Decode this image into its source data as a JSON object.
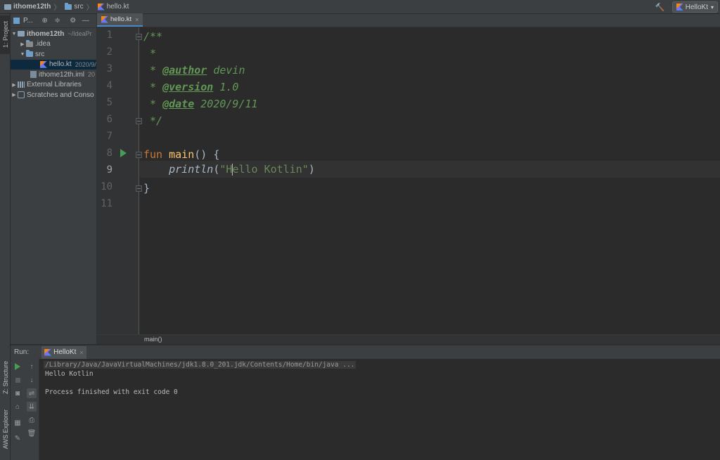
{
  "navbar": {
    "breadcrumb": [
      "ithome12th",
      "src",
      "hello.kt"
    ],
    "run_config": "HelloKt"
  },
  "left_strip": {
    "project_tab": "1: Project",
    "structure_tab": "Z: Structure",
    "aws_tab": "AWS Explorer"
  },
  "project_panel": {
    "title": "P...",
    "tree": [
      {
        "label": "ithome12th",
        "extra": "~/IdeaPr",
        "level": 0
      },
      {
        "label": ".idea",
        "level": 1
      },
      {
        "label": "src",
        "level": 1
      },
      {
        "label": "hello.kt",
        "extra": "2020/9/",
        "level": 2,
        "selected": true
      },
      {
        "label": "ithome12th.iml",
        "extra": "20",
        "level": 1
      },
      {
        "label": "External Libraries",
        "level": 0
      },
      {
        "label": "Scratches and Conso",
        "level": 0
      }
    ]
  },
  "editor": {
    "tab": "hello.kt",
    "line_numbers": [
      "1",
      "2",
      "3",
      "4",
      "5",
      "6",
      "7",
      "8",
      "9",
      "10",
      "11"
    ],
    "code": {
      "l1": "/**",
      "l2": " *",
      "l3_star": " * ",
      "l3_tag": "@author",
      "l3_val": " devin",
      "l4_star": " * ",
      "l4_tag": "@version",
      "l4_val": " 1.0",
      "l5_star": " * ",
      "l5_tag": "@date",
      "l5_val": " 2020/9/11",
      "l6": " */",
      "l8_kw": "fun ",
      "l8_fn": "main",
      "l8_rest": "() {",
      "l9_indent": "    ",
      "l9_fn": "println",
      "l9_open": "(",
      "l9_str_a": "\"H",
      "l9_str_b": "ello Kotlin\"",
      "l9_close": ")",
      "l10": "}"
    },
    "breadcrumb": "main()"
  },
  "run_panel": {
    "label": "Run:",
    "tab": "HelloKt",
    "console": [
      "/Library/Java/JavaVirtualMachines/jdk1.8.0_201.jdk/Contents/Home/bin/java ...",
      "Hello Kotlin",
      "",
      "Process finished with exit code 0"
    ]
  },
  "colors": {
    "keyword": "#cc7832",
    "function": "#ffc66d",
    "string": "#6a8759",
    "doc_comment": "#629755",
    "run_green": "#499c54"
  },
  "icons": [
    "folder-icon",
    "kotlin-file-icon",
    "hammer-icon",
    "target-icon",
    "collapse-icon",
    "gear-icon",
    "minimize-icon",
    "run-icon",
    "stop-icon",
    "wrap-icon",
    "print-icon",
    "trash-icon",
    "pin-icon"
  ]
}
